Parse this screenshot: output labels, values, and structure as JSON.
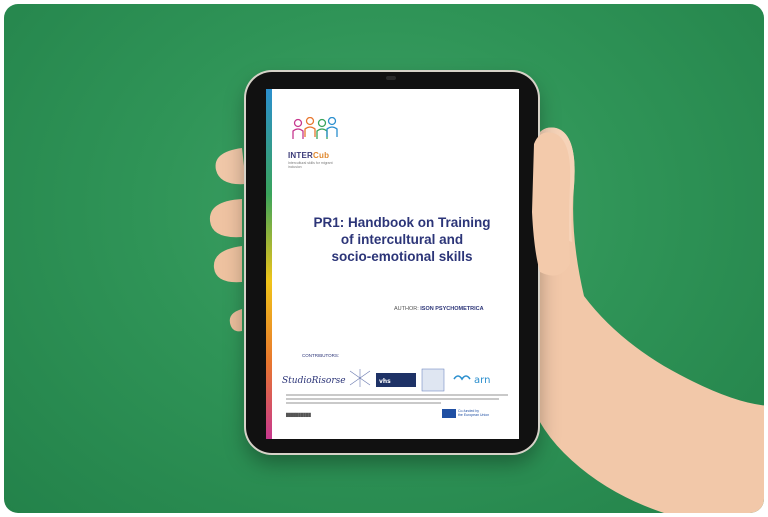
{
  "handbook": {
    "logo_name": "INTER",
    "logo_suffix": "Cub",
    "logo_tagline": "Intercultural skills for migrant inclusion",
    "title_line1": "PR1: Handbook on Training",
    "title_line2": "of intercultural and",
    "title_line3": "socio-emotional skills",
    "author_label": "AUTHOR:",
    "author_name": "ISON PSYCHOMETRICA",
    "contributors_label": "CONTRIBUTORS:",
    "contributor_logos": [
      "StudioRisorse",
      "vhs",
      "arn"
    ],
    "eu_label_line1": "Co-funded by",
    "eu_label_line2": "the European Union"
  },
  "colors": {
    "background": "#2f9457",
    "title": "#2c3578",
    "tablet_frame": "#111111"
  }
}
